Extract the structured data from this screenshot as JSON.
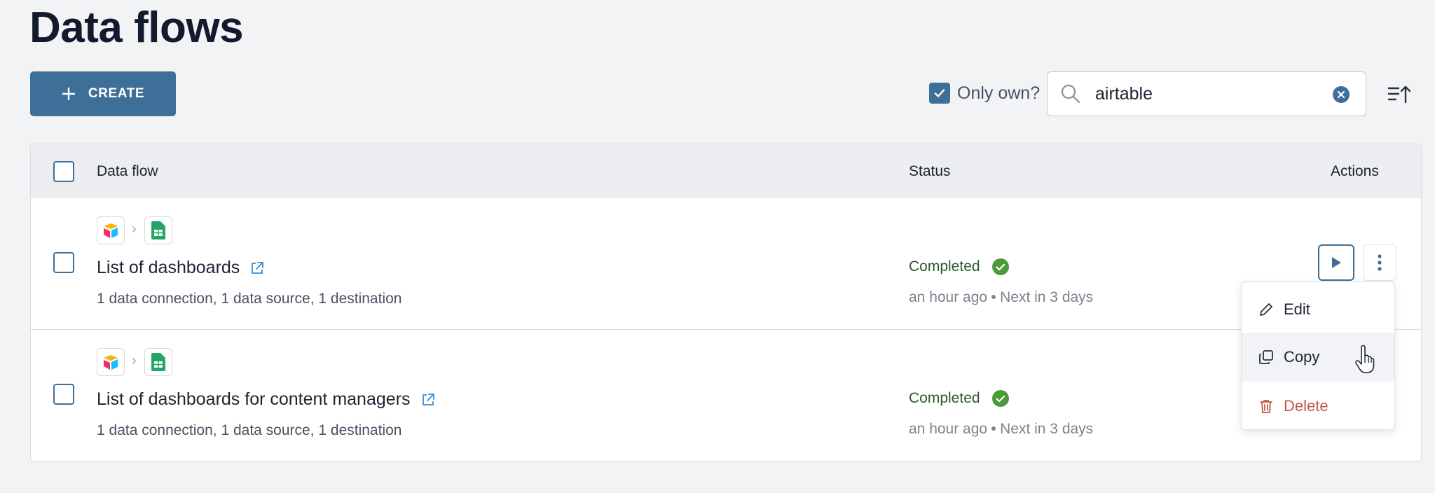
{
  "page": {
    "title": "Data flows"
  },
  "toolbar": {
    "create_label": "CREATE",
    "only_own_label": "Only own?",
    "only_own_checked": true,
    "search_value": "airtable"
  },
  "table": {
    "headers": {
      "flow": "Data flow",
      "status": "Status",
      "actions": "Actions"
    },
    "rows": [
      {
        "name": "List of dashboards",
        "meta": "1 data connection,  1 data source,  1 destination",
        "status": "Completed",
        "last_run": "an hour ago",
        "next_run": "Next in 3 days",
        "source_icon": "airtable-icon",
        "destination_icon": "google-sheets-icon"
      },
      {
        "name": "List of dashboards for content managers",
        "meta": "1 data connection,  1 data source,  1 destination",
        "status": "Completed",
        "last_run": "an hour ago",
        "next_run": "Next in 3 days",
        "source_icon": "airtable-icon",
        "destination_icon": "google-sheets-icon"
      }
    ]
  },
  "context_menu": {
    "items": [
      {
        "label": "Edit",
        "icon": "pencil-icon"
      },
      {
        "label": "Copy",
        "icon": "copy-icon"
      },
      {
        "label": "Delete",
        "icon": "trash-icon"
      }
    ]
  },
  "colors": {
    "accent": "#3d6f99",
    "success": "#4c9a3a",
    "danger": "#c0564a"
  }
}
